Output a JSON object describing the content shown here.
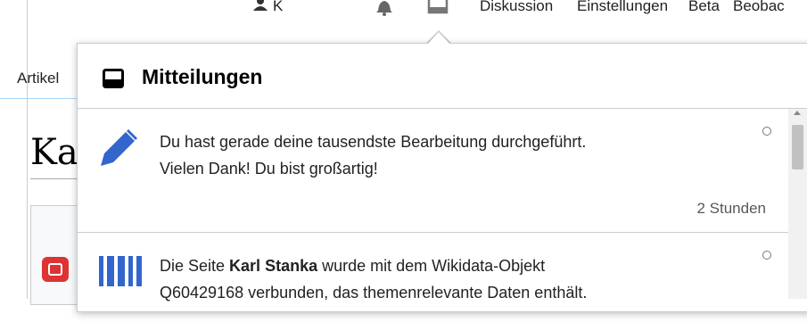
{
  "topbar": {
    "user_label": "K",
    "discussion": "Diskussion",
    "settings": "Einstellungen",
    "beta": "Beta",
    "watchlist": "Beobac"
  },
  "page": {
    "tab_article": "Artikel",
    "heading_fragment": "Ka"
  },
  "popup": {
    "title": "Mitteilungen",
    "notifications": [
      {
        "icon": "pencil-icon",
        "line1": "Du hast gerade deine tausendste Bearbeitung durchgeführt.",
        "line2": "Vielen Dank! Du bist großartig!",
        "time": "2 Stunden"
      },
      {
        "icon": "wikidata-icon",
        "pre": "Die Seite ",
        "bold": "Karl Stanka",
        "post": " wurde mit dem Wikidata-Objekt",
        "line2": "Q60429168 verbunden, das themenrelevante Daten enthält."
      }
    ]
  },
  "colors": {
    "accent": "#3366cc",
    "border": "#c8ccd1",
    "red_badge": "#dd3333"
  }
}
